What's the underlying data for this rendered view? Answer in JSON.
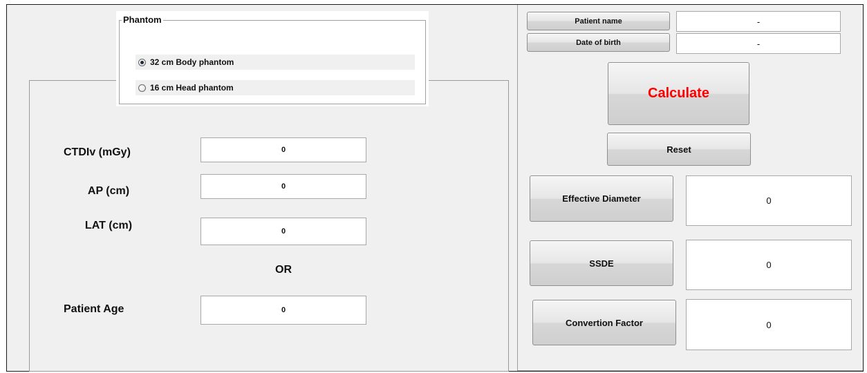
{
  "phantom": {
    "title": "Phantom",
    "options": [
      {
        "label": "32 cm Body phantom",
        "selected": true
      },
      {
        "label": "16 cm Head phantom",
        "selected": false
      }
    ]
  },
  "inputs": {
    "ctdi": {
      "label": "CTDIv (mGy)",
      "value": "0"
    },
    "ap": {
      "label": "AP (cm)",
      "value": "0"
    },
    "lat": {
      "label": "LAT (cm)",
      "value": "0"
    },
    "or_label": "OR",
    "age": {
      "label": "Patient Age",
      "value": "0"
    }
  },
  "patient": {
    "name_label": "Patient name",
    "name_value": "-",
    "dob_label": "Date of birth",
    "dob_value": "-"
  },
  "actions": {
    "calculate": "Calculate",
    "calculate_color": "#ff0000",
    "reset": "Reset"
  },
  "outputs": {
    "effective_diameter": {
      "label": "Effective Diameter",
      "value": "0"
    },
    "ssde": {
      "label": "SSDE",
      "value": "0"
    },
    "conversion_factor": {
      "label": "Convertion Factor",
      "value": "0"
    }
  }
}
